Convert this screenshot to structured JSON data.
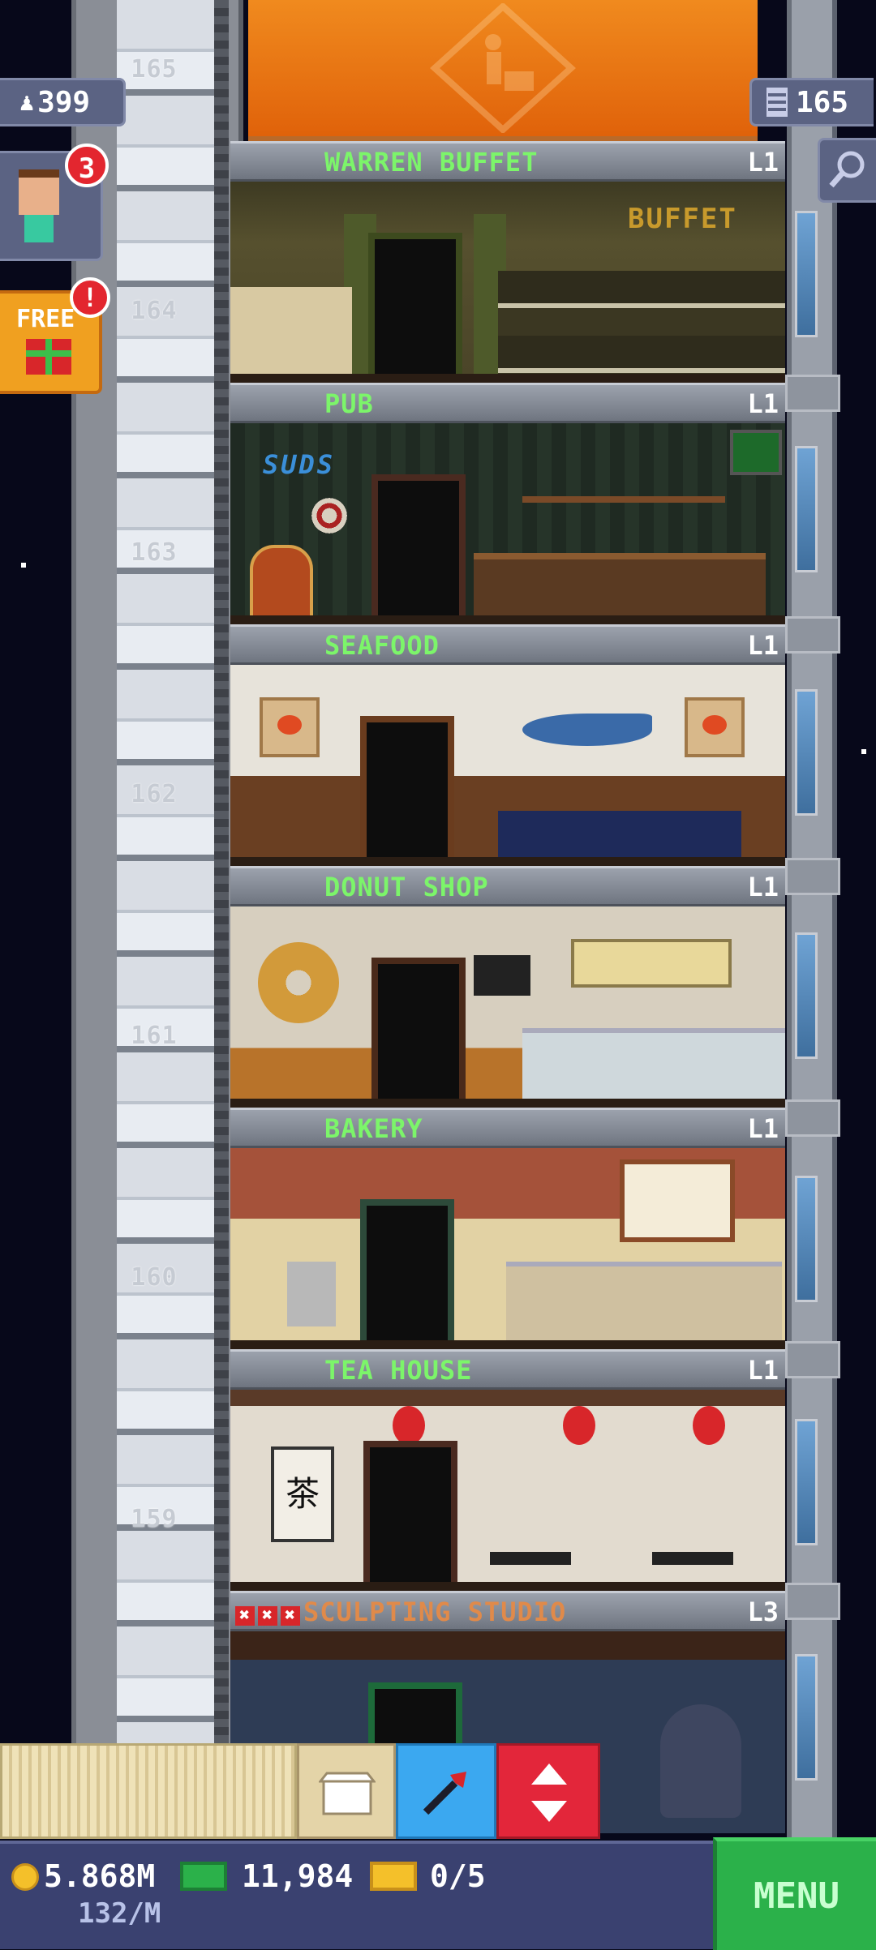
{
  "hud": {
    "population": "399",
    "floor_count": "165",
    "profile_notifications": "3",
    "free_gift_label": "FREE",
    "free_gift_alert": "!"
  },
  "shaft_floor_numbers": [
    "165",
    "164",
    "163",
    "162",
    "161",
    "160",
    "159"
  ],
  "floors": [
    {
      "name": "WARREN BUFFET",
      "level": "L1",
      "sign": "BUFFET"
    },
    {
      "name": "PUB",
      "level": "L1",
      "sign": "SUDS"
    },
    {
      "name": "SEAFOOD",
      "level": "L1"
    },
    {
      "name": "DONUT SHOP",
      "level": "L1"
    },
    {
      "name": "BAKERY",
      "level": "L1"
    },
    {
      "name": "TEA HOUSE",
      "level": "L1",
      "sign": "茶"
    },
    {
      "name": "SCULPTING STUDIO",
      "level": "L3",
      "warnings": 3
    }
  ],
  "bottom_bar": {
    "coins": "5.868M",
    "coins_rate": "132/M",
    "bux": "11,984",
    "tickets": "0/5",
    "menu_label": "MENU"
  },
  "colors": {
    "floor_name": "#7cf56a",
    "menu_green": "#2bb14a",
    "hud_bg": "#5b6383",
    "alert_red": "#e3262f"
  }
}
